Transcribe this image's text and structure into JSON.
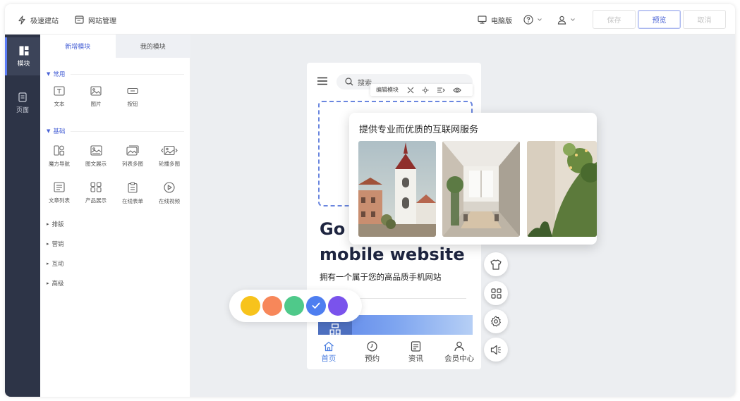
{
  "topbar": {
    "quick_build": "极速建站",
    "site_manage": "网站管理",
    "device": "电脑版",
    "save": "保存",
    "preview": "预览",
    "cancel": "取消"
  },
  "left_nav": {
    "items": [
      {
        "label": "模块",
        "icon": "module-icon",
        "active": true
      },
      {
        "label": "页面",
        "icon": "page-icon",
        "active": false
      }
    ]
  },
  "panel": {
    "tabs": [
      "新增模块",
      "我的模块"
    ],
    "sections": {
      "common": "常用",
      "basic": "基础",
      "layout": "排版",
      "marketing": "营销",
      "interact": "互动",
      "advanced": "高级"
    },
    "common_modules": [
      "文本",
      "图片",
      "按钮"
    ],
    "basic_modules_row1": [
      "魔方导航",
      "图文展示",
      "列表多图",
      "轮播多图"
    ],
    "basic_modules_row2": [
      "文章列表",
      "产品展示",
      "在线表单",
      "在线视频"
    ]
  },
  "phone": {
    "search_placeholder": "搜索",
    "toolbar_label": "编辑模块",
    "hero_title": "Go Mobile website",
    "hero_title_visible_line1": "Go M",
    "hero_title_visible_line2": "mobile website",
    "hero_subtitle": "拥有一个属于您的高品质手机网站",
    "banner_glyph": "品",
    "bottom_nav": [
      "首页",
      "预约",
      "资讯",
      "会员中心"
    ]
  },
  "card": {
    "title": "提供专业而优质的互联网服务"
  },
  "swatches": {
    "colors": [
      "#f7c31c",
      "#f7875a",
      "#4fc98a",
      "#4e7ef0",
      "#7a53ec"
    ],
    "selected_index": 3
  },
  "colors": {
    "accent": "#4a63d6",
    "nav_bg": "#2d3447"
  }
}
